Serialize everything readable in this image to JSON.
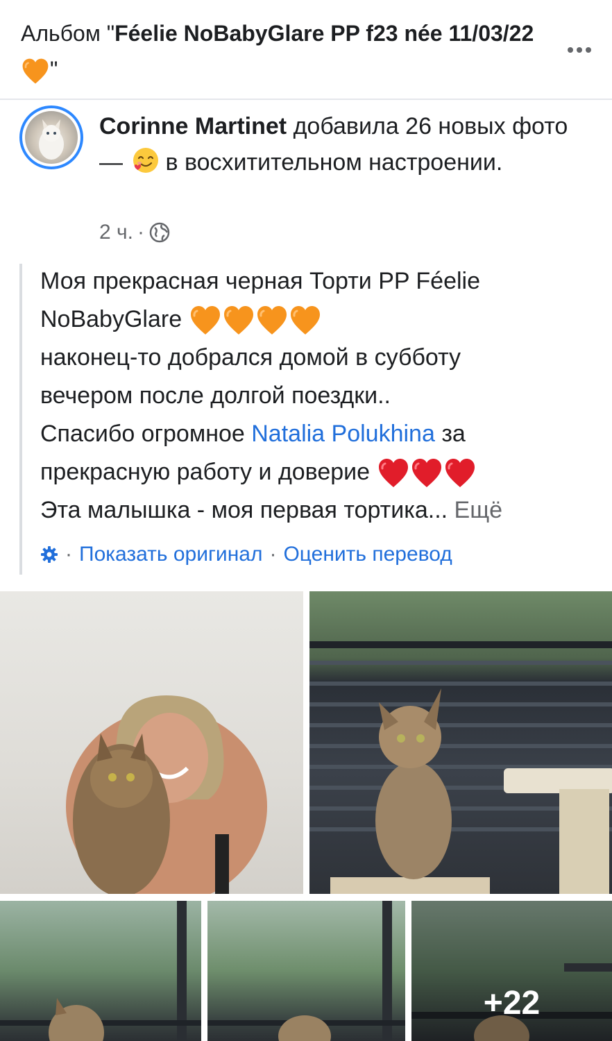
{
  "header": {
    "album_prefix": "Альбом \"",
    "album_name": "Féelie NoBabyGlare PP f23 née 11/03/22",
    "album_suffix": "\""
  },
  "post": {
    "author": "Corinne Martinet",
    "action_text": " добавила 26 новых фото — ",
    "feeling_text": "в восхитительном настроении.",
    "time": "2 ч.",
    "meta_separator": "·",
    "body": {
      "line1": "Моя прекрасная черная Торти PP Féelie",
      "line2": "NoBabyGlare",
      "line3": "наконец-то добрался домой в субботу",
      "line4": "вечером после долгой поездки..",
      "line5_pre": "Спасибо огромное ",
      "line5_link": "Natalia Polukhina",
      "line5_post": " за",
      "line6": "прекрасную работу и доверие",
      "line7": "Эта малышка - моя первая тортика... ",
      "more": "Ещё"
    },
    "translation": {
      "show_original": "Показать оригинал",
      "rate_translation": "Оценить перевод",
      "separator": "·"
    }
  },
  "photos": {
    "remaining_count": "+22"
  },
  "colors": {
    "link": "#216fdb",
    "orange_heart": "#f7941d",
    "red_heart": "#e11d2a",
    "avatar_ring": "#2d88ff"
  },
  "icons": [
    "more-icon",
    "globe-icon",
    "gear-icon",
    "orange-heart-icon",
    "red-heart-icon",
    "feeling-emoji-icon"
  ]
}
